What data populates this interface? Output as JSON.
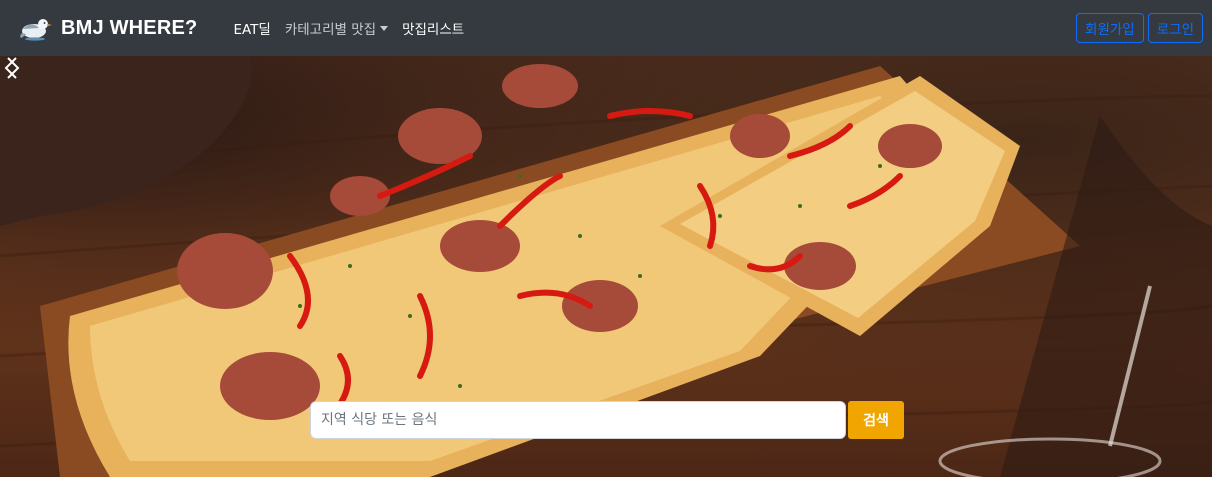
{
  "navbar": {
    "brand_icon": "seagull-icon",
    "brand_text": "BMJ WHERE?",
    "links": [
      {
        "label": "EAT딜"
      },
      {
        "label": "카테고리별 맛집"
      },
      {
        "label": "맛집리스트"
      }
    ],
    "signup_label": "회원가입",
    "login_label": "로그인"
  },
  "hero": {
    "prev_icon": "chevron-left-icon",
    "next_icon": "chevron-right-icon"
  },
  "search": {
    "placeholder": "지역 식당 또는 음식",
    "value": "",
    "button_label": "검색"
  },
  "colors": {
    "navbar_bg": "#343a40",
    "accent_blue": "#0d6efd",
    "search_button": "#f0a500"
  }
}
